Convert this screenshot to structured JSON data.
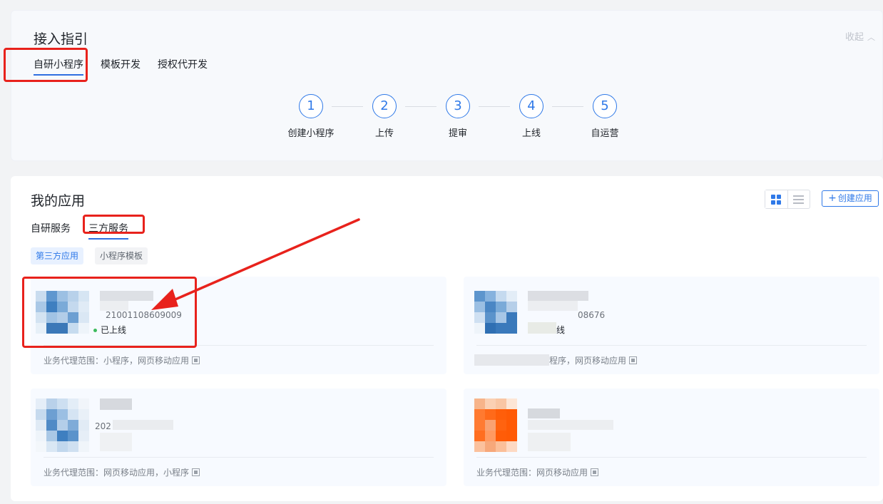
{
  "guide": {
    "title": "接入指引",
    "collapse_label": "收起",
    "tabs": [
      {
        "label": "自研小程序",
        "active": true
      },
      {
        "label": "模板开发",
        "active": false
      },
      {
        "label": "授权代开发",
        "active": false
      }
    ],
    "steps": [
      {
        "num": "1",
        "label": "创建小程序"
      },
      {
        "num": "2",
        "label": "上传"
      },
      {
        "num": "3",
        "label": "提审"
      },
      {
        "num": "4",
        "label": "上线"
      },
      {
        "num": "5",
        "label": "自运营"
      }
    ]
  },
  "apps": {
    "title": "我的应用",
    "view_modes": [
      "grid-icon",
      "list-icon"
    ],
    "active_view": "grid",
    "create_label": "创建应用",
    "tabs": [
      {
        "label": "自研服务",
        "active": false
      },
      {
        "label": "三方服务",
        "active": true
      }
    ],
    "filters": [
      {
        "label": "第三方应用",
        "active": true
      },
      {
        "label": "小程序模板",
        "active": false
      }
    ],
    "cards": [
      {
        "appid": "21001108609009",
        "status": "已上线",
        "scope": "业务代理范围：小程序，网页移动应用"
      },
      {
        "appid": "08676",
        "status": "线",
        "scope": "程序，网页移动应用"
      },
      {
        "appid": "202",
        "status": "",
        "scope": "业务代理范围：网页移动应用，小程序"
      },
      {
        "appid": "",
        "status": "",
        "scope": "业务代理范围：网页移动应用"
      }
    ]
  },
  "colors": {
    "accent": "#2f79e8",
    "highlight": "#e8221c",
    "online": "#3dbb5d"
  }
}
